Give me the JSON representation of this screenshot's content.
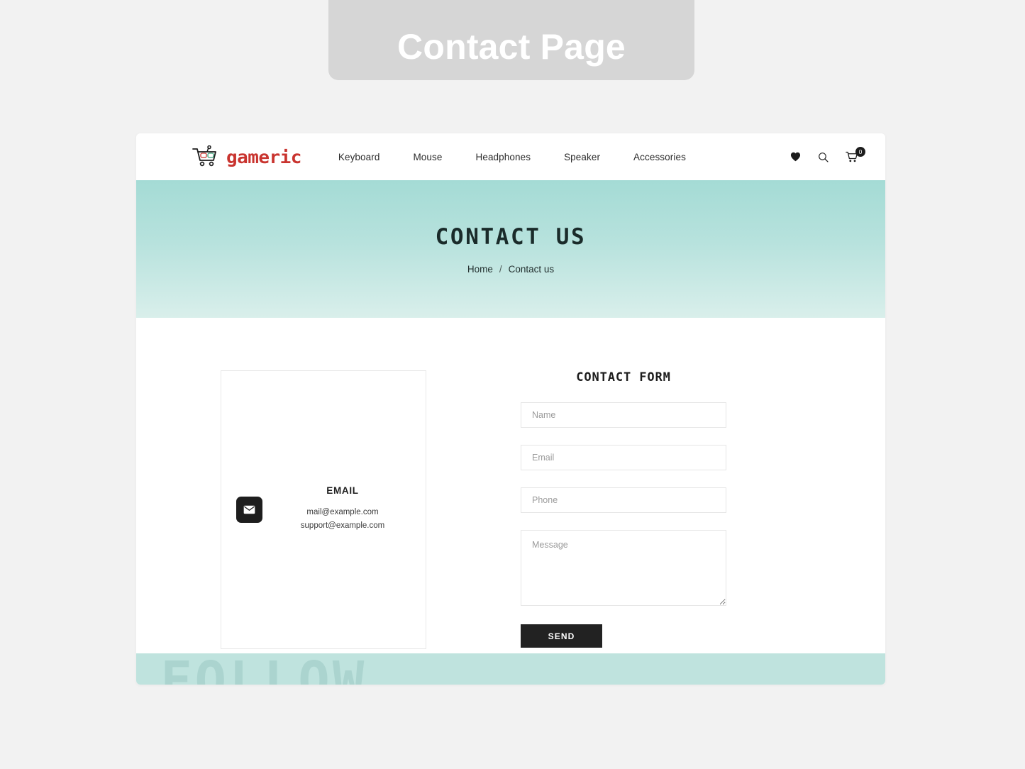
{
  "page_label": {
    "text": "Contact Page"
  },
  "header": {
    "brand": {
      "name": "gameric",
      "logo_icon": "shopping-cart-gamepad-logo",
      "color": "#c9342f"
    },
    "nav": [
      {
        "label": "Keyboard"
      },
      {
        "label": "Mouse"
      },
      {
        "label": "Headphones"
      },
      {
        "label": "Speaker"
      },
      {
        "label": "Accessories"
      }
    ],
    "icons": {
      "wishlist": "heart-icon",
      "search": "search-icon",
      "cart": "cart-icon",
      "cart_count": "0"
    }
  },
  "hero": {
    "title": "CONTACT US",
    "breadcrumb": {
      "home": "Home",
      "separator": "/",
      "current": "Contact us"
    },
    "gradient_top": "#a4dbd5",
    "gradient_bottom": "#d9efeb"
  },
  "contact_info": {
    "title": "EMAIL",
    "icon": "envelope-icon",
    "lines": [
      "mail@example.com",
      "support@example.com"
    ]
  },
  "contact_form": {
    "title": "CONTACT FORM",
    "fields": [
      {
        "name": "name",
        "placeholder": "Name",
        "value": ""
      },
      {
        "name": "email",
        "placeholder": "Email",
        "value": ""
      },
      {
        "name": "phone",
        "placeholder": "Phone",
        "value": ""
      }
    ],
    "message": {
      "placeholder": "Message",
      "value": ""
    },
    "submit_label": "SEND",
    "submit_color": "#222222"
  },
  "footer": {
    "ghost_text": "FOLLOW",
    "background": "#bfe3de"
  }
}
